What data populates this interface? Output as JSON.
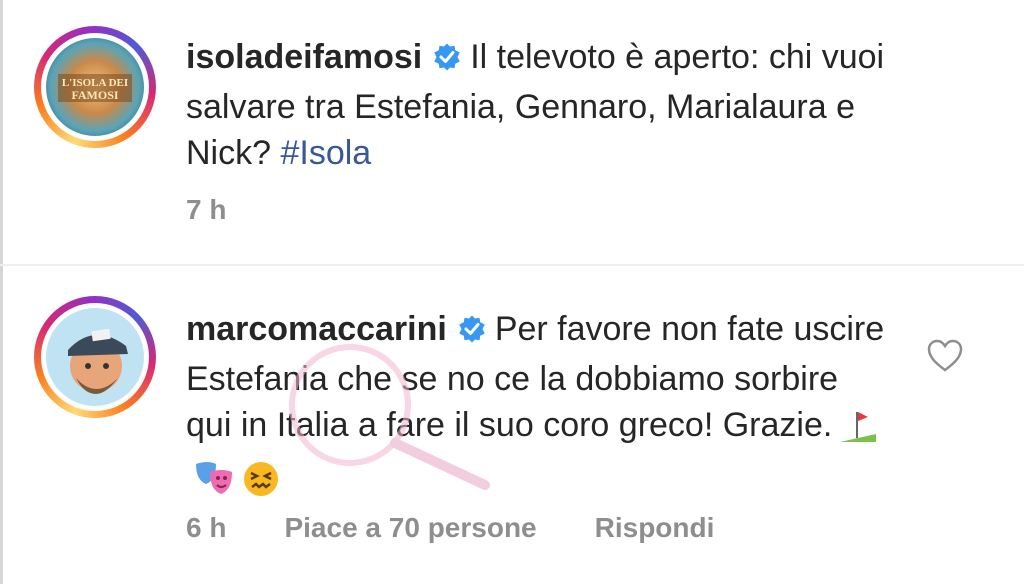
{
  "comments": [
    {
      "username": "isoladeifamosi",
      "verified": true,
      "text_before": "Il televoto è aperto: chi vuoi salvare tra Estefania, Gennaro, Marialaura e Nick?",
      "hashtag": "#Isola",
      "time": "7 h",
      "avatar": "isola-dei-famosi-logo",
      "avatar_text": "L'ISOLA DEI FAMOSI"
    },
    {
      "username": "marcomaccarini",
      "verified": true,
      "text": "Per favore non fate uscire Estefania che se no ce la dobbiamo sorbire qui in Italia  a fare il suo coro greco! Grazie.",
      "emojis": [
        "golf-flag-emoji",
        "performing-arts-emoji",
        "confounded-face-emoji"
      ],
      "time": "6 h",
      "likes_label": "Piace a 70 persone",
      "reply_label": "Rispondi"
    }
  ],
  "colors": {
    "verified_blue": "#3897f0",
    "hashtag": "#385898",
    "meta_gray": "#8e8e8e",
    "text": "#262626"
  }
}
